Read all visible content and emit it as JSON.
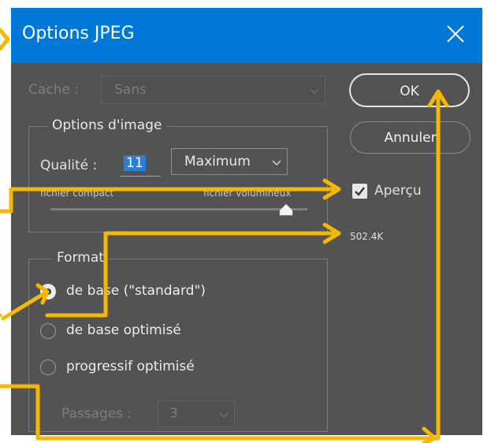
{
  "window": {
    "title": "Options JPEG"
  },
  "cache": {
    "label": "Cache :",
    "value": "Sans"
  },
  "image_options": {
    "legend": "Options d'image",
    "quality_label": "Qualité :",
    "quality_value": "11",
    "quality_preset": "Maximum",
    "slider_min_label": "fichier compact",
    "slider_max_label": "fichier volumineux",
    "quality_max": 12
  },
  "buttons": {
    "ok": "OK",
    "cancel": "Annuler"
  },
  "preview": {
    "label": "Aperçu",
    "checked": true,
    "file_size": "502.4K"
  },
  "format": {
    "legend": "Format",
    "options": [
      {
        "label": "de base  (\"standard\")",
        "selected": true
      },
      {
        "label": "de base optimisé",
        "selected": false
      },
      {
        "label": "progressif optimisé",
        "selected": false
      }
    ],
    "passes_label": "Passages :",
    "passes_value": "3"
  },
  "annotation_color": "#f5b800"
}
